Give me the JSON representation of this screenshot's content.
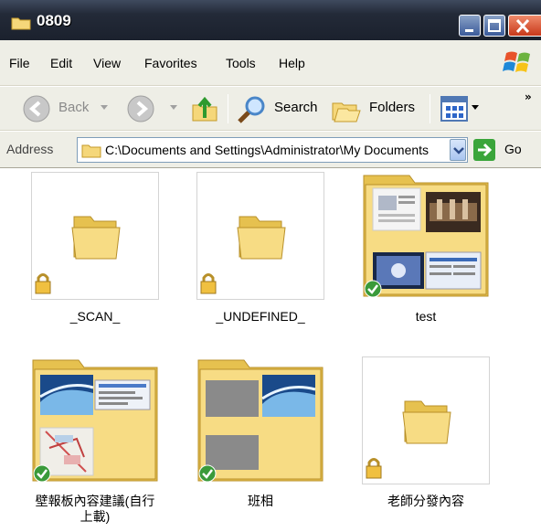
{
  "window": {
    "title": "0809"
  },
  "menu": {
    "items": [
      "File",
      "Edit",
      "View",
      "Favorites",
      "Tools",
      "Help"
    ]
  },
  "toolbar": {
    "back": "Back",
    "search": "Search",
    "folders": "Folders"
  },
  "address": {
    "label": "Address",
    "value": "C:\\Documents and Settings\\Administrator\\My Documents",
    "go": "Go"
  },
  "items": [
    {
      "name": "_SCAN_",
      "type": "folder",
      "badge": "lock"
    },
    {
      "name": "_UNDEFINED_",
      "type": "folder",
      "badge": "lock"
    },
    {
      "name": "test",
      "type": "folder-preview",
      "badge": "check"
    },
    {
      "name": "壁報板內容建議(自行\n上載)",
      "type": "folder-preview",
      "badge": "check"
    },
    {
      "name": "班相",
      "type": "folder-preview",
      "badge": "check"
    },
    {
      "name": "老師分發內容",
      "type": "folder",
      "badge": "lock"
    }
  ],
  "colors": {
    "folder": "#f5d77a",
    "titlebar": "#232a38",
    "close": "#c8381a"
  }
}
